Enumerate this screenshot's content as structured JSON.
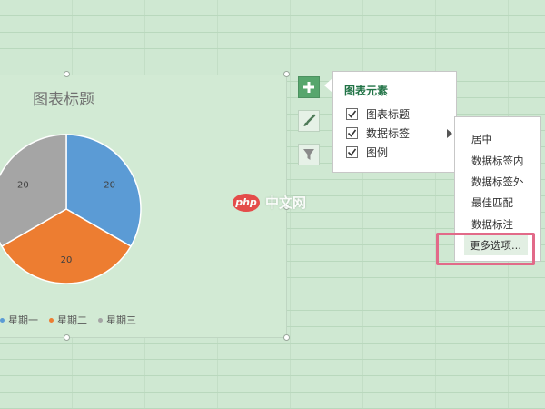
{
  "chart": {
    "title": "图表标题",
    "legend": [
      {
        "label": "星期一"
      },
      {
        "label": "星期二"
      },
      {
        "label": "星期三"
      }
    ]
  },
  "chart_data": {
    "type": "pie",
    "title": "图表标题",
    "categories": [
      "星期一",
      "星期二",
      "星期三"
    ],
    "values": [
      20,
      20,
      20
    ],
    "data_labels": [
      "20",
      "20",
      "20"
    ],
    "colors": [
      "#5b9bd5",
      "#ed7d31",
      "#a5a5a5"
    ],
    "legend_position": "bottom"
  },
  "sidebar_buttons": {
    "elements": {
      "icon": "plus-icon"
    },
    "styles": {
      "icon": "paintbrush-icon"
    },
    "filter": {
      "icon": "funnel-icon"
    }
  },
  "chart_elements_panel": {
    "title": "图表元素",
    "options": [
      {
        "label": "图表标题",
        "checked": true
      },
      {
        "label": "数据标签",
        "checked": true,
        "has_submenu": true
      },
      {
        "label": "图例",
        "checked": true
      }
    ]
  },
  "data_label_submenu": {
    "items": [
      "居中",
      "数据标签内",
      "数据标签外",
      "最佳匹配",
      "数据标注",
      "更多选项..."
    ]
  },
  "watermark": {
    "logo": "php",
    "text": "中文网"
  },
  "colors": {
    "accent": "#217346",
    "highlight_border": "#e26a89",
    "button_active": "#57a66d"
  }
}
